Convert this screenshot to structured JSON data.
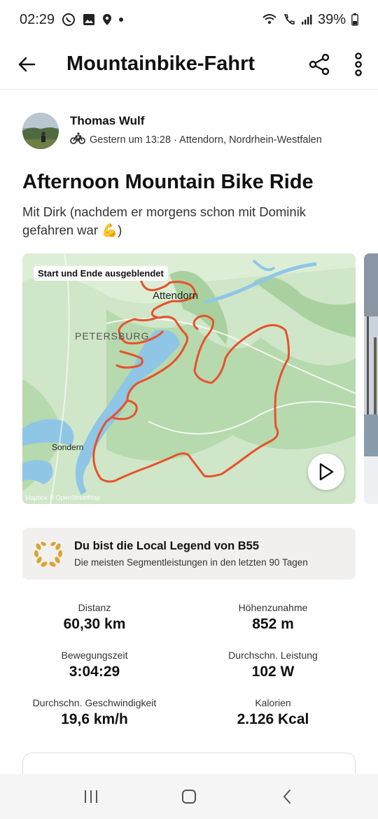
{
  "status_bar": {
    "time": "02:29",
    "battery": "39%"
  },
  "app_bar": {
    "title": "Mountainbike-Fahrt"
  },
  "athlete": {
    "name": "Thomas Wulf",
    "meta": "Gestern um 13:28 · Attendorn, Nordrhein-Westfalen"
  },
  "activity": {
    "title": "Afternoon Mountain Bike Ride",
    "description": "Mit Dirk (nachdem er morgens schon mit Dominik gefahren war 💪)"
  },
  "map": {
    "notice": "Start und Ende ausgeblendet",
    "labels": {
      "town1": "Attendorn",
      "town2": "PETERSBURG",
      "town3": "Sondern"
    },
    "attribution": "Mapbox © OpenStreetMap",
    "route_color": "#e8512a"
  },
  "legend": {
    "title": "Du bist die Local Legend von B55",
    "subtitle": "Die meisten Segmentleistungen in den letzten 90 Tagen"
  },
  "stats": [
    {
      "label": "Distanz",
      "value": "60,30 km"
    },
    {
      "label": "Höhenzunahme",
      "value": "852 m"
    },
    {
      "label": "Bewegungszeit",
      "value": "3:04:29"
    },
    {
      "label": "Durchschn. Leistung",
      "value": "102 W"
    },
    {
      "label": "Durchschn. Geschwindigkeit",
      "value": "19,6 km/h"
    },
    {
      "label": "Kalorien",
      "value": "2.126 Kcal"
    }
  ]
}
